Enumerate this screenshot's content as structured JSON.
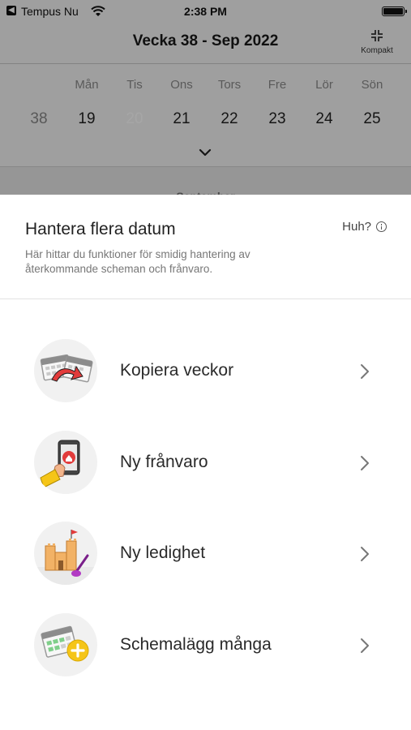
{
  "status_bar": {
    "back_app": "Tempus Nu",
    "time": "2:38 PM"
  },
  "nav": {
    "title": "Vecka 38 - Sep 2022",
    "compact_label": "Kompakt"
  },
  "week": {
    "day_names": [
      "Mån",
      "Tis",
      "Ons",
      "Tors",
      "Fre",
      "Lör",
      "Sön"
    ],
    "week_number": "38",
    "dates": [
      "19",
      "20",
      "21",
      "22",
      "23",
      "24",
      "25"
    ],
    "selected_index": 1
  },
  "month_label": "September",
  "sheet": {
    "title": "Hantera flera datum",
    "description": "Här hittar du funktioner för smidig hantering av återkommande scheman och frånvaro.",
    "help_label": "Huh?"
  },
  "options": [
    {
      "label": "Kopiera veckor",
      "icon": "copy-weeks-icon"
    },
    {
      "label": "Ny frånvaro",
      "icon": "absence-icon"
    },
    {
      "label": "Ny ledighet",
      "icon": "leave-icon"
    },
    {
      "label": "Schemalägg många",
      "icon": "schedule-many-icon"
    }
  ],
  "colors": {
    "accent_green": "#2e8b3e",
    "add_yellow": "#f5c518"
  }
}
